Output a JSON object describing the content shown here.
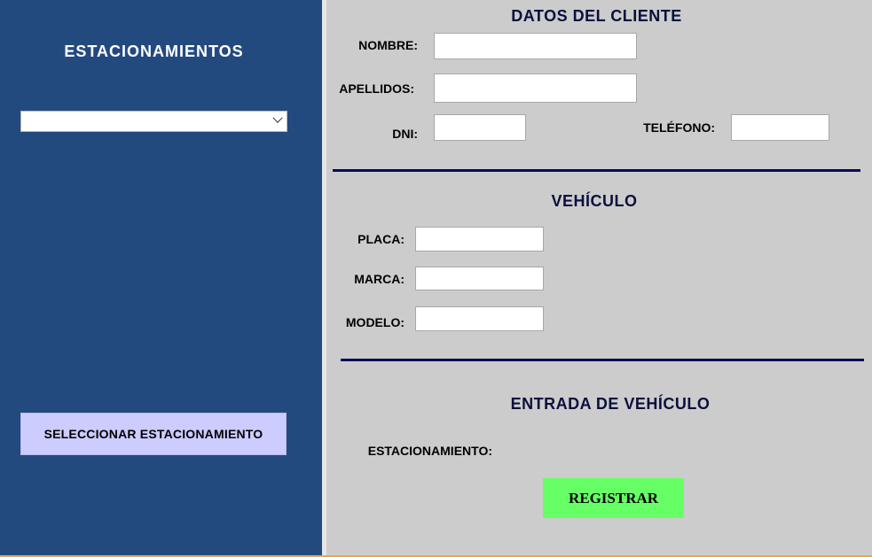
{
  "sidebar": {
    "title": "ESTACIONAMIENTOS",
    "select_value": "",
    "select_button": "SELECCIONAR ESTACIONAMIENTO"
  },
  "cliente": {
    "title": "DATOS DEL CLIENTE",
    "nombre_label": "NOMBRE:",
    "apellidos_label": "APELLIDOS:",
    "dni_label": "DNI:",
    "telefono_label": "TELÉFONO:"
  },
  "vehiculo": {
    "title": "VEHÍCULO",
    "placa_label": "PLACA:",
    "marca_label": "MARCA:",
    "modelo_label": "MODELO:"
  },
  "entrada": {
    "title": "ENTRADA DE VEHÍCULO",
    "estacionamiento_label": "ESTACIONAMIENTO:",
    "estacionamiento_value": "",
    "register_button": "REGISTRAR"
  },
  "colors": {
    "sidebar_bg": "#234a7f",
    "panel_bg": "#cccccc",
    "select_button_bg": "#ccccff",
    "register_button_bg": "#66ff66",
    "heading_color": "#0a0f3c",
    "rule_color": "#0a0a55"
  },
  "icons": {
    "select_arrow": "chevron-down-icon"
  }
}
